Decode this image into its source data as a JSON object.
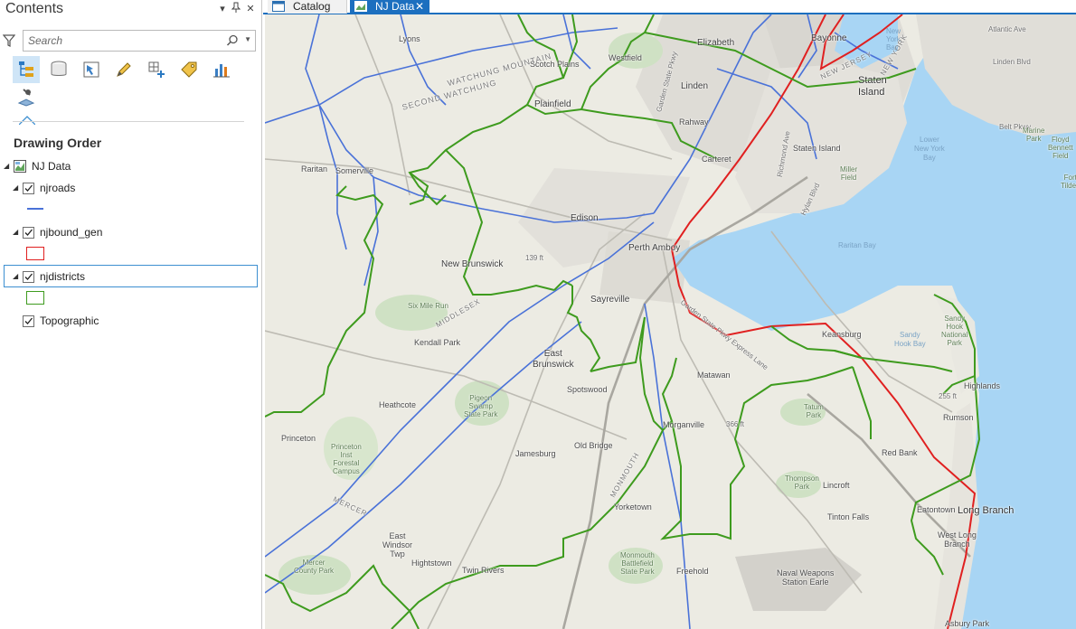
{
  "contents_pane": {
    "title": "Contents",
    "search_placeholder": "Search",
    "section_heading": "Drawing Order",
    "toolbar_icons": [
      "list-by-drawing-order-icon",
      "list-by-data-source-icon",
      "list-by-selection-icon",
      "list-by-editing-icon",
      "list-by-snapping-icon",
      "list-by-labeling-icon",
      "list-by-charts-icon",
      "list-by-perspective-imagery-icon"
    ],
    "tree": {
      "map": "NJ Data",
      "layers": [
        {
          "name": "njroads",
          "checked": true,
          "symbol": "line",
          "color": "#4a72d8"
        },
        {
          "name": "njbound_gen",
          "checked": true,
          "symbol": "polygon",
          "color": "#e02020"
        },
        {
          "name": "njdistricts",
          "checked": true,
          "symbol": "polygon",
          "color": "#3e9b1e",
          "selected": true
        },
        {
          "name": "Topographic",
          "checked": true,
          "symbol": "basemap"
        }
      ]
    }
  },
  "tabs": [
    {
      "label": "Catalog",
      "active": false
    },
    {
      "label": "NJ Data",
      "active": true
    }
  ],
  "map": {
    "labels": {
      "lyons": "Lyons",
      "scotch_plains": "Scotch Plains",
      "westfield": "Westfield",
      "elizabeth": "Elizabeth",
      "linden": "Linden",
      "bayonne": "Bayonne",
      "staten_island": "Staten\nIsland",
      "plainfield": "Plainfield",
      "second_watchung": "SECOND WATCHUNG",
      "watchung_mountain": "WATCHUNG MOUNTAIN",
      "rahway": "Rahway",
      "carteret": "Carteret",
      "staten_island_small": "Staten Island",
      "raritan": "Raritan",
      "somerville": "Somerville",
      "edison": "Edison",
      "perth_amboy": "Perth Amboy",
      "raritan_bay": "Raritan Bay",
      "new_brunswick": "New Brunswick",
      "sayreville": "Sayreville",
      "lower_ny_bay": "Lower\nNew York\nBay",
      "six_mile_run": "Six Mile Run",
      "middlesex": "MIDDLESEX",
      "kendall_park": "Kendall Park",
      "east_brunswick": "East\nBrunswick",
      "keansburg": "Keansburg",
      "sandy_hook_bay": "Sandy\nHook Bay",
      "matawan": "Matawan",
      "highlands": "Highlands",
      "heathcote": "Heathcote",
      "spotswood": "Spotswood",
      "pigeon_swamp": "Pigeon\nSwamp\nState Park",
      "morganville": "Morganville",
      "tatum_park": "Tatum\nPark",
      "rumson": "Rumson",
      "princeton": "Princeton",
      "princeton_forest": "Princeton\nInst\nForestal\nCampus",
      "old_bridge": "Old Bridge",
      "jamesburg": "Jamesburg",
      "red_bank": "Red Bank",
      "thompson_park": "Thompson\nPark",
      "lincroft": "Lincroft",
      "mercer": "MERCER",
      "yorketown": "Yorketown",
      "tinton_falls": "Tinton Falls",
      "eatontown": "Eatontown",
      "long_branch": "Long Branch",
      "west_long_branch": "West Long\nBranch",
      "east_windsor": "East\nWindsor\nTwp",
      "hightstown": "Hightstown",
      "twin_rivers": "Twin Rivers",
      "monmouth_battlefield": "Monmouth\nBattlefield\nState Park",
      "freehold": "Freehold",
      "naval_weapons": "Naval Weapons\nStation Earle",
      "mercer_county_park": "Mercer\nCounty Park",
      "asbury_park": "Asbury Park",
      "atlantic_ave": "Atlantic Ave",
      "linden_blvd": "Linden Blvd",
      "belt_pkwy": "Belt Pkwy",
      "floyd_bennett": "Floyd\nBennett\nField",
      "marine_park": "Marine\nPark",
      "miller_field": "Miller\nField",
      "sandy_hook_park": "Sandy\nHook\nNational\nPark",
      "fort_tilden": "Fort\nTilden",
      "jacob_riis": "Jacob",
      "new_york": "NEW YORK",
      "new_jersey": "NEW JERSEY",
      "ny_small": "New\nYork\nBay",
      "elev_139": "139 ft",
      "elev_255": "255 ft",
      "elev_366": "366 ft",
      "monmouth": "MONMOUTH",
      "hylan_blvd": "Hylan Blvd",
      "gsp_exp": "Garden State Pkwy Express Lane",
      "gsp": "Garden State Pkwy",
      "richmond_ave": "Richmond Ave",
      "nj_tpke": "New Jersey Tpke"
    }
  }
}
